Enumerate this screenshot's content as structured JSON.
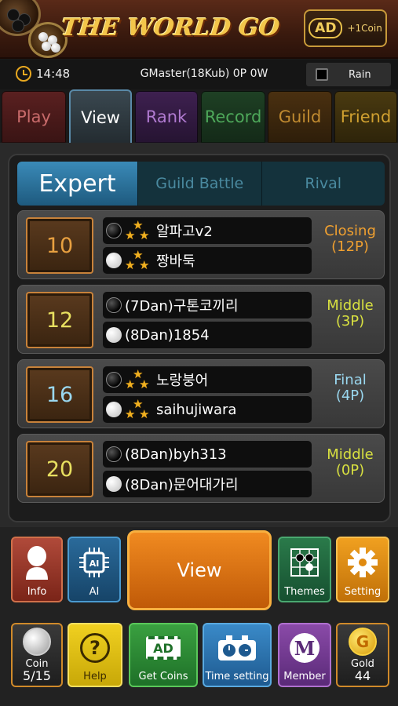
{
  "header": {
    "title": "THE WORLD GO",
    "ad_badge": "AD",
    "ad_reward": "+1Coin"
  },
  "status": {
    "time": "14:48",
    "user": "GMaster(18Kub) 0P 0W",
    "rain_label": "Rain",
    "rain_checked": false
  },
  "tabs": [
    {
      "label": "Play"
    },
    {
      "label": "View",
      "active": true
    },
    {
      "label": "Rank"
    },
    {
      "label": "Record"
    },
    {
      "label": "Guild"
    },
    {
      "label": "Friend"
    }
  ],
  "subtabs": [
    {
      "label": "Expert",
      "active": true
    },
    {
      "label": "Guild Battle"
    },
    {
      "label": "Rival"
    }
  ],
  "games": [
    {
      "moves": "10",
      "moves_color": "#e8a040",
      "black": {
        "stars": 3,
        "name": "알파고v2"
      },
      "white": {
        "stars": 3,
        "name": "짱바둑"
      },
      "status_line1": "Closing",
      "status_line2": "(12P)",
      "status_color": "#f0a030"
    },
    {
      "moves": "12",
      "moves_color": "#e8e060",
      "black": {
        "stars": 0,
        "name": "(7Dan)구톤코끼리"
      },
      "white": {
        "stars": 0,
        "name": "(8Dan)1854"
      },
      "status_line1": "Middle",
      "status_line2": "(3P)",
      "status_color": "#d8e040"
    },
    {
      "moves": "16",
      "moves_color": "#9ad8f0",
      "black": {
        "stars": 3,
        "name": "노랑붕어"
      },
      "white": {
        "stars": 3,
        "name": "saihujiwara"
      },
      "status_line1": "Final",
      "status_line2": "(4P)",
      "status_color": "#9ad8f0"
    },
    {
      "moves": "20",
      "moves_color": "#e8e060",
      "black": {
        "stars": 0,
        "name": "(8Dan)byh313"
      },
      "white": {
        "stars": 0,
        "name": "(8Dan)문어대가리"
      },
      "status_line1": "Middle",
      "status_line2": "(0P)",
      "status_color": "#d8e040"
    }
  ],
  "buttons": {
    "info": "Info",
    "ai": "AI",
    "ai_chip": "AI",
    "view": "View",
    "themes": "Themes",
    "setting": "Setting",
    "coin_label": "Coin",
    "coin_count": "5/15",
    "help": "Help",
    "help_glyph": "?",
    "get_coins": "Get Coins",
    "get_coins_ad": "AD",
    "time_setting": "Time setting",
    "member": "Member",
    "member_glyph": "M",
    "gold_label": "Gold",
    "gold_count": "44",
    "gold_glyph": "G"
  }
}
